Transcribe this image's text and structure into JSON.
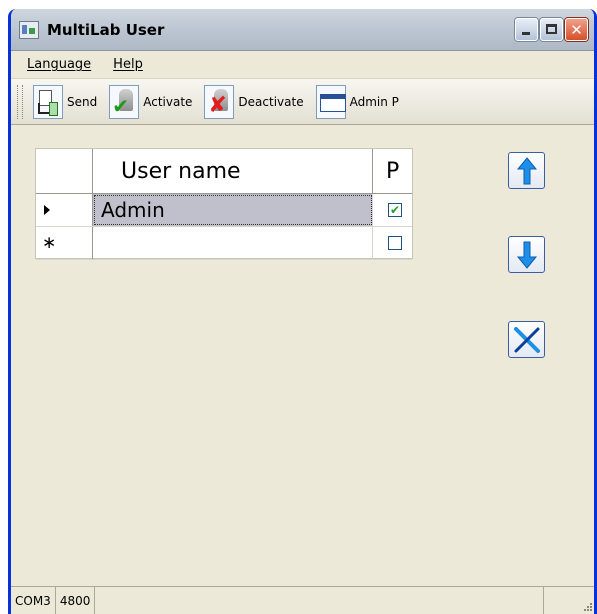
{
  "window": {
    "title": "MultiLab User",
    "app_icon": "multilab-app-icon",
    "buttons": {
      "minimize": "minimize",
      "maximize": "maximize",
      "close": "close"
    }
  },
  "menu": {
    "items": [
      {
        "label": "Language"
      },
      {
        "label": "Help"
      }
    ]
  },
  "toolbar": {
    "buttons": [
      {
        "label": "Send",
        "icon": "send-to-device-icon"
      },
      {
        "label": "Activate",
        "icon": "keys-check-icon"
      },
      {
        "label": "Deactivate",
        "icon": "keys-cross-icon"
      },
      {
        "label": "Admin P",
        "icon": "admin-window-icon"
      }
    ]
  },
  "grid": {
    "columns": [
      {
        "label": ""
      },
      {
        "label": "User name"
      },
      {
        "label": "P"
      }
    ],
    "rows": [
      {
        "marker": "▶",
        "user_name": "Admin",
        "p_checked": true,
        "selected": true
      },
      {
        "marker": "∗",
        "user_name": "",
        "p_checked": false,
        "selected": false
      }
    ]
  },
  "side_buttons": [
    {
      "name": "move-up",
      "icon": "arrow-up-icon"
    },
    {
      "name": "move-down",
      "icon": "arrow-down-icon"
    },
    {
      "name": "delete",
      "icon": "pen-cross-icon"
    }
  ],
  "status": {
    "port": "COM3",
    "baud": "4800"
  },
  "colors": {
    "title_bar_border": "#0831d9",
    "button_arrow": "#1e8fe8",
    "checkmark": "#21a121",
    "cross": "#e01e1e"
  }
}
